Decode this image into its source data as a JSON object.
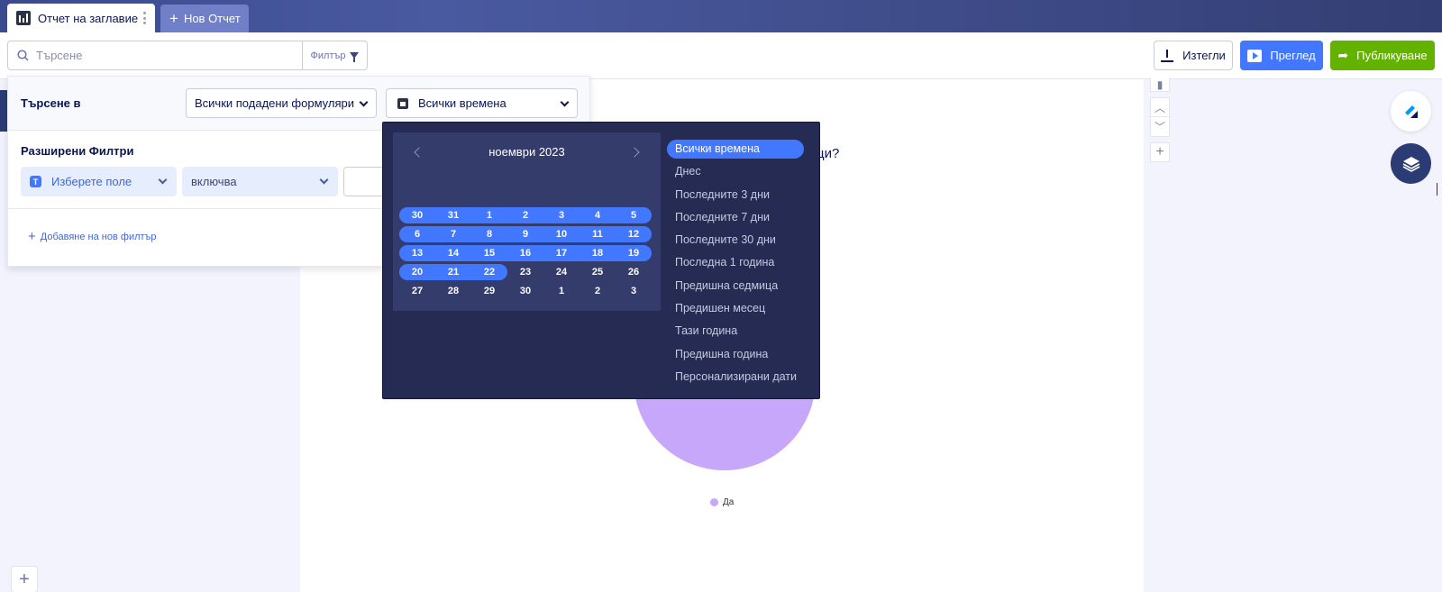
{
  "tabs": {
    "active_label": "Отчет на заглавие",
    "new_label": "Нов Отчет"
  },
  "toolbar": {
    "search_placeholder": "Търсене",
    "filter_label": "Филтър",
    "download_label": "Изтегли",
    "preview_label": "Преглед",
    "publish_label": "Публикуване"
  },
  "filter_panel": {
    "search_in_label": "Търсене в",
    "forms_select": "Всички подадени формуляри",
    "time_select": "Всички времена",
    "advanced_title": "Разширени Филтри",
    "field_select": "Изберете поле",
    "field_icon_letter": "T",
    "operator_select": "включва",
    "add_filter_label": "Добавяне на нов филтър"
  },
  "datepicker": {
    "month_label": "ноември 2023",
    "weeks": [
      [
        "30",
        "31",
        "1",
        "2",
        "3",
        "4",
        "5"
      ],
      [
        "6",
        "7",
        "8",
        "9",
        "10",
        "11",
        "12"
      ],
      [
        "13",
        "14",
        "15",
        "16",
        "17",
        "18",
        "19"
      ],
      [
        "20",
        "21",
        "22",
        "23",
        "24",
        "25",
        "26"
      ],
      [
        "27",
        "28",
        "29",
        "30",
        "1",
        "2",
        "3"
      ]
    ],
    "highlighted_days_per_week": [
      7,
      7,
      7,
      3,
      0
    ],
    "presets": [
      "Всички времена",
      "Днес",
      "Последните 3 дни",
      "Последните 7 дни",
      "Последните 30 дни",
      "Последна 1 година",
      "Предишна седмица",
      "Предишен месец",
      "Тази година",
      "Предишна година",
      "Персонализирани дати"
    ],
    "active_preset_index": 0
  },
  "report": {
    "question_fragment": "ци?",
    "legend_label": "Да",
    "legend_color": "#c7a7fa"
  },
  "colors": {
    "accent": "#4277ff",
    "publish": "#64b200",
    "picker_bg": "#252b53"
  }
}
